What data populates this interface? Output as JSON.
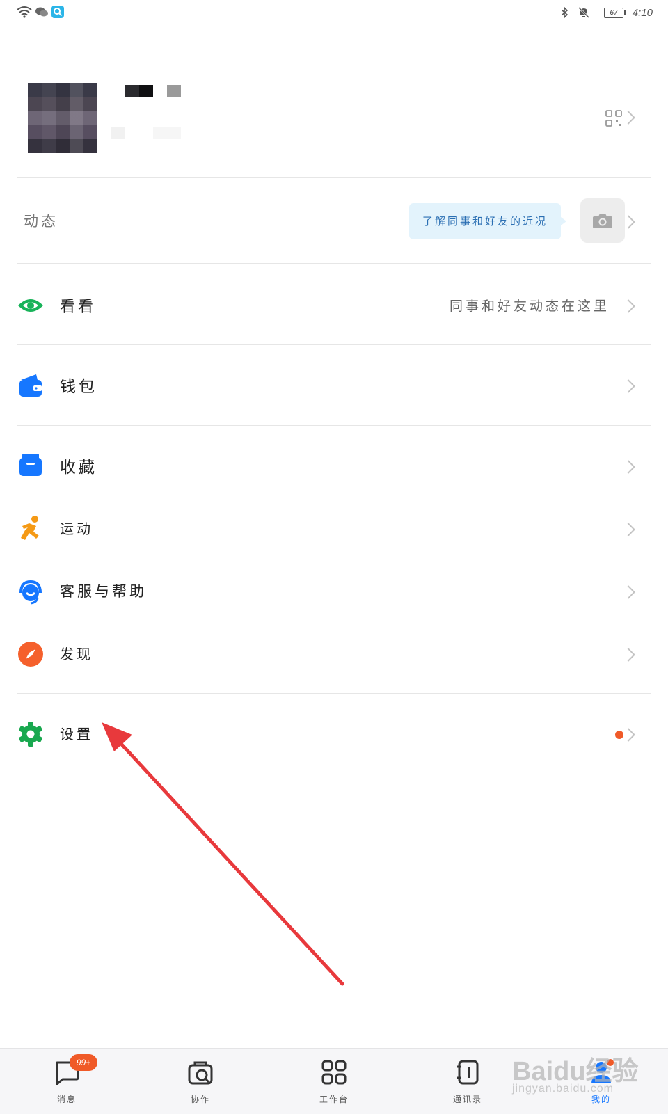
{
  "status_bar": {
    "time": "4:10",
    "battery": "67"
  },
  "moments": {
    "label": "动态",
    "bubble_text": "了解同事和好友的近况"
  },
  "menu": {
    "kankan": {
      "label": "看看",
      "hint": "同事和好友动态在这里"
    },
    "wallet": {
      "label": "钱包"
    },
    "favorites": {
      "label": "收藏"
    },
    "sports": {
      "label": "运动"
    },
    "service": {
      "label": "客服与帮助"
    },
    "discover": {
      "label": "发现"
    },
    "settings": {
      "label": "设置"
    }
  },
  "tabs": [
    {
      "label": "消息",
      "badge": "99+"
    },
    {
      "label": "协作"
    },
    {
      "label": "工作台"
    },
    {
      "label": "通讯录"
    },
    {
      "label": "我的"
    }
  ],
  "watermark": {
    "main": "Baidu经验",
    "sub": "jingyan.baidu.com"
  },
  "colors": {
    "accent": "#1677ff",
    "badge": "#f05a28",
    "annotation_arrow": "#e8393c"
  }
}
